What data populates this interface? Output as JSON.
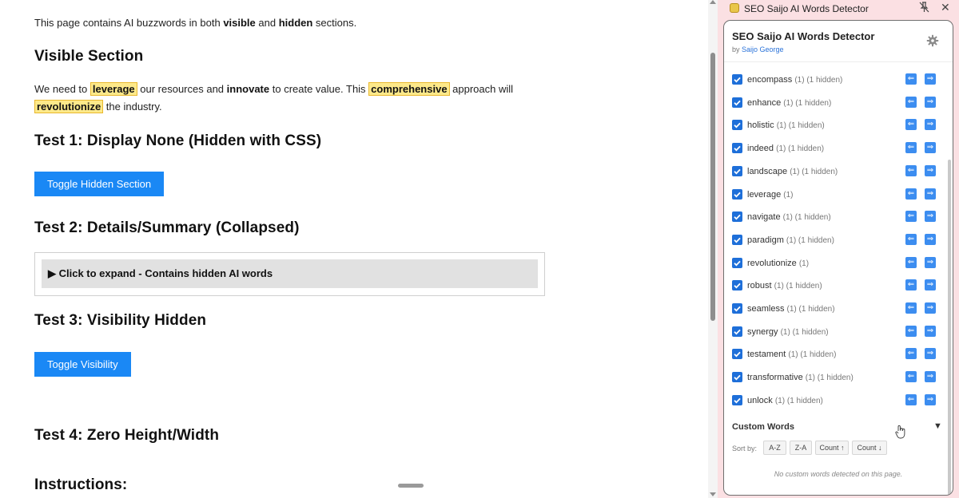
{
  "page": {
    "intro": {
      "prefix": "This page contains AI buzzwords in both ",
      "visible": "visible",
      "and": " and ",
      "hidden": "hidden",
      "suffix": " sections."
    },
    "visible_section": {
      "heading": "Visible Section",
      "p1_a": "We need to ",
      "hl_leverage": "leverage",
      "p1_b": " our resources and ",
      "bold_innovate": "innovate",
      "p1_c": " to create value. This ",
      "hl_comprehensive": "comprehensive",
      "p1_d": " approach will",
      "hl_revolutionize": "revolutionize",
      "p1_e": " the industry."
    },
    "test1": {
      "heading": "Test 1: Display None (Hidden with CSS)",
      "button": "Toggle Hidden Section"
    },
    "test2": {
      "heading": "Test 2: Details/Summary (Collapsed)",
      "summary": "▶ Click to expand - Contains hidden AI words"
    },
    "test3": {
      "heading": "Test 3: Visibility Hidden",
      "button": "Toggle Visibility"
    },
    "test4": {
      "heading": "Test 4: Zero Height/Width"
    },
    "instructions": {
      "heading": "Instructions:"
    }
  },
  "panel": {
    "window_title": "SEO Saijo AI Words Detector",
    "pin_icon": "pin-off-icon",
    "close_icon": "close-icon",
    "app_title": "SEO Saijo AI Words Detector",
    "by": "by ",
    "author": "Saijo George",
    "settings_icon": "gear-icon",
    "words": [
      {
        "word": "encompass",
        "count": "(1) (1 hidden)"
      },
      {
        "word": "enhance",
        "count": "(1) (1 hidden)"
      },
      {
        "word": "holistic",
        "count": "(1) (1 hidden)"
      },
      {
        "word": "indeed",
        "count": "(1) (1 hidden)"
      },
      {
        "word": "landscape",
        "count": "(1) (1 hidden)"
      },
      {
        "word": "leverage",
        "count": "(1)"
      },
      {
        "word": "navigate",
        "count": "(1) (1 hidden)"
      },
      {
        "word": "paradigm",
        "count": "(1) (1 hidden)"
      },
      {
        "word": "revolutionize",
        "count": "(1)"
      },
      {
        "word": "robust",
        "count": "(1) (1 hidden)"
      },
      {
        "word": "seamless",
        "count": "(1) (1 hidden)"
      },
      {
        "word": "synergy",
        "count": "(1) (1 hidden)"
      },
      {
        "word": "testament",
        "count": "(1) (1 hidden)"
      },
      {
        "word": "transformative",
        "count": "(1) (1 hidden)"
      },
      {
        "word": "unlock",
        "count": "(1) (1 hidden)"
      }
    ],
    "nav_prev": "⇐",
    "nav_next": "⇒",
    "custom_words": {
      "title": "Custom Words",
      "toggle": "▼",
      "sort_label": "Sort by:",
      "sort_options": [
        "A-Z",
        "Z-A",
        "Count ↑",
        "Count ↓"
      ],
      "empty": "No custom words detected on this page."
    }
  }
}
